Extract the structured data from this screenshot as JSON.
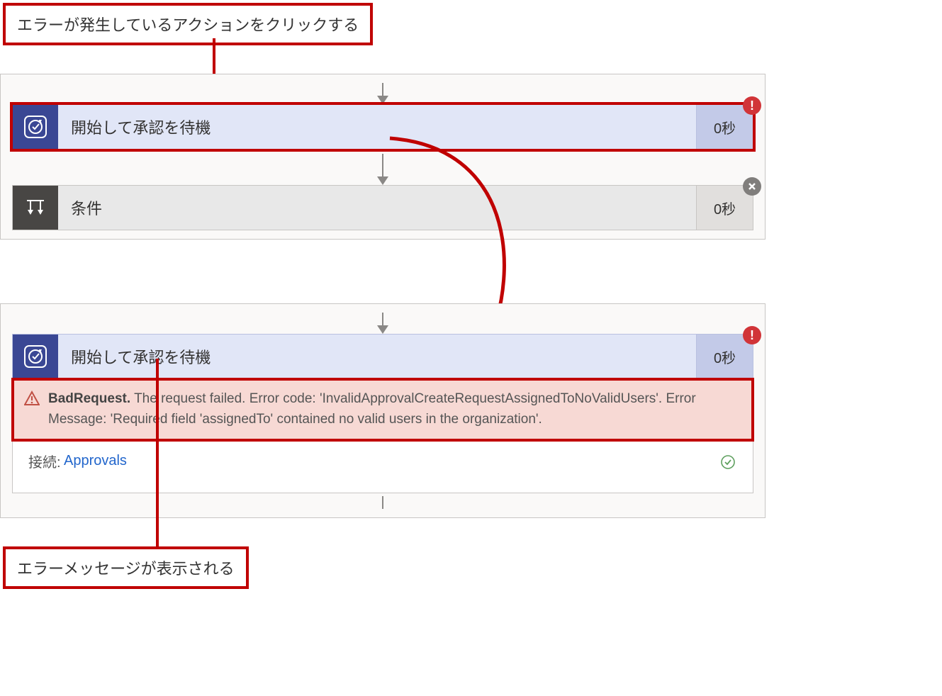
{
  "callouts": {
    "top": "エラーが発生しているアクションをクリックする",
    "bottom": "エラーメッセージが表示される"
  },
  "panel1": {
    "approval": {
      "label": "開始して承認を待機",
      "duration": "0秒",
      "status": "error"
    },
    "condition": {
      "label": "条件",
      "duration": "0秒",
      "status": "skipped"
    }
  },
  "panel2": {
    "approval": {
      "label": "開始して承認を待機",
      "duration": "0秒",
      "status": "error"
    },
    "error": {
      "title": "BadRequest.",
      "body": " The request failed. Error code: 'InvalidApprovalCreateRequestAssignedToNoValidUsers'. Error Message: 'Required field 'assignedTo' contained no valid users in the organization'."
    },
    "connection": {
      "label": "接続:",
      "value": "Approvals",
      "status": "ok"
    }
  }
}
